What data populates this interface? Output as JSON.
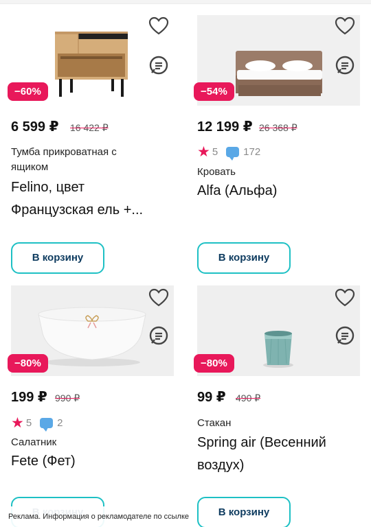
{
  "currency": "₽",
  "products": [
    {
      "discount": "−60%",
      "price": "6 599 ₽",
      "old_price": "16 422 ₽",
      "category": "Тумба прикроватная с ящиком",
      "name": "Felino, цвет Французская ель +...",
      "cart_label": "В корзину",
      "icons": [
        "heart-icon",
        "chat-icon"
      ]
    },
    {
      "discount": "−54%",
      "price": "12 199 ₽",
      "old_price": "26 368 ₽",
      "rating": "5",
      "reviews": "172",
      "category": "Кровать",
      "name": "Alfa (Альфа)",
      "cart_label": "В корзину",
      "icons": [
        "heart-icon",
        "chat-icon"
      ]
    },
    {
      "discount": "−80%",
      "price": "199 ₽",
      "old_price": "990 ₽",
      "rating": "5",
      "reviews": "2",
      "category": "Салатник",
      "name": "Fete (Фет)",
      "cart_label": "В корзину",
      "icons": [
        "heart-icon",
        "chat-icon"
      ]
    },
    {
      "discount": "−80%",
      "price": "99 ₽",
      "old_price": "490 ₽",
      "category": "Стакан",
      "name": "Spring air (Весенний воздух)",
      "cart_label": "В корзину",
      "icons": [
        "heart-icon",
        "chat-icon"
      ]
    }
  ],
  "ad_notice": "Реклама. Информация о рекламодателе по ссылке",
  "colors": {
    "accent": "#e8185a",
    "button_border": "#1dc0c4",
    "button_text": "#0f3c60",
    "review_bubble": "#5aa8e6"
  }
}
